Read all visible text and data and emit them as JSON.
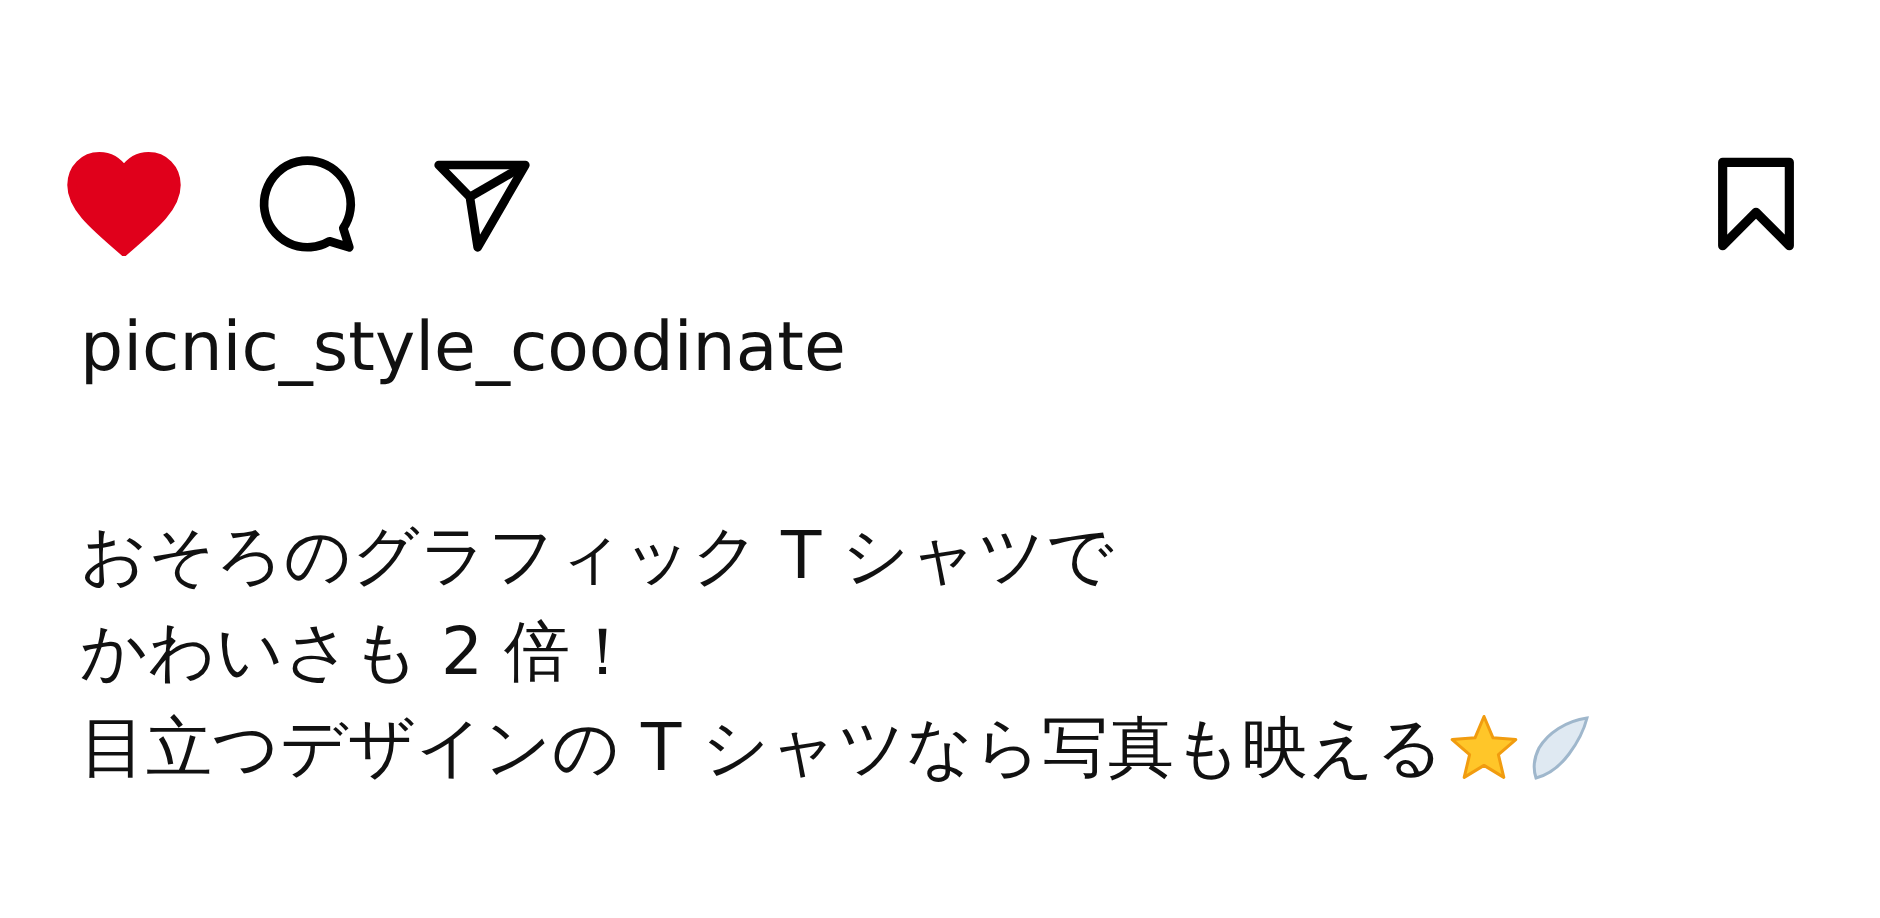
{
  "actions": {
    "liked": true,
    "saved": false
  },
  "username": "picnic_style_coodinate",
  "caption": [
    "おそろのグラフィック T シャツで",
    "かわいさも 2 倍！",
    "目立つデザインの T シャツなら写真も映える"
  ]
}
